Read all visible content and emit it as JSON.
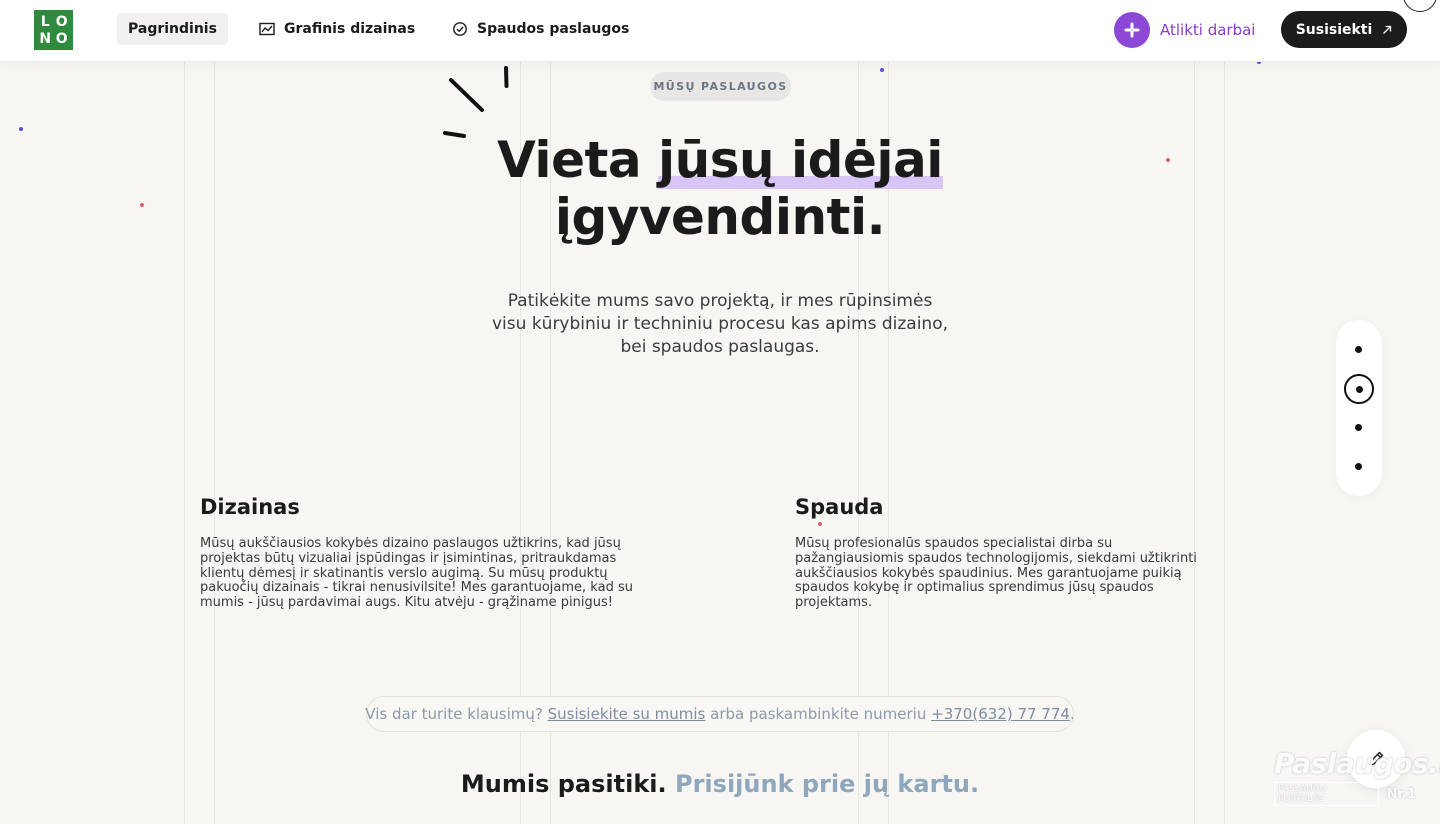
{
  "header": {
    "logo_letters": [
      "L",
      "O",
      "N",
      "O"
    ],
    "nav": [
      {
        "label": "Pagrindinis",
        "icon": "none",
        "active": true
      },
      {
        "label": "Grafinis dizainas",
        "icon": "chart-icon",
        "active": false
      },
      {
        "label": "Spaudos paslaugos",
        "icon": "check-circle-icon",
        "active": false
      }
    ],
    "works_label": "Atlikti darbai",
    "works_icon": "slack-icon",
    "contact_label": "Susisiekti",
    "contact_icon": "arrow-up-right-icon"
  },
  "hero": {
    "badge": "MŪSŲ PASLAUGOS",
    "title_pre": "Vieta ",
    "title_highlight": "jūsų idėjai",
    "title_post": "įgyvendinti.",
    "subtitle": "Patikėkite mums savo projektą, ir mes rūpinsimės visu kūrybiniu ir techniniu procesu kas apims dizaino, bei spaudos paslaugas."
  },
  "services": [
    {
      "title": "Dizainas",
      "text": "Mūsų aukščiausios kokybės dizaino paslaugos užtikrins, kad jūsų projektas būtų vizualiai įspūdingas ir įsimintinas, pritraukdamas klientų dėmesį ir skatinantis verslo augimą. Su mūsų produktų pakuočių dizainais - tikrai nenusivilsite! Mes garantuojame, kad su mumis - jūsų pardavimai augs. Kitu atvėju - grąžiname pinigus!"
    },
    {
      "title": "Spauda",
      "text": "Mūsų profesionalūs spaudos specialistai dirba su pažangiausiomis spaudos technologijomis, siekdami užtikrinti aukščiausios kokybės spaudinius. Mes garantuojame puikią spaudos kokybę ir optimalius sprendimus jūsų spaudos projektams."
    }
  ],
  "pager": {
    "count": 4,
    "active_index": 1
  },
  "cta": {
    "text_before": "Vis dar turite klausimų? ",
    "link_label": "Susisiekite su mumis",
    "text_middle": " arba paskambinkite numeriu ",
    "phone": "+370(632) 77 774",
    "text_after": "."
  },
  "trust": {
    "part1": "Mumis pasitiki.",
    "part2": "Prisijūnk prie jų kartu."
  },
  "edit_icon": "pencil-icon",
  "watermark": {
    "main": "Paslaugos.lt",
    "sub": "PASLAUGŲ PORTALAS",
    "nr": "Nr.1"
  },
  "colors": {
    "accent_purple": "#8c49d8",
    "highlight": "#d7c6f5",
    "dark": "#1c1c1c",
    "logo_green": "#2e8b3e",
    "muted_blue": "#8fa7bd"
  }
}
